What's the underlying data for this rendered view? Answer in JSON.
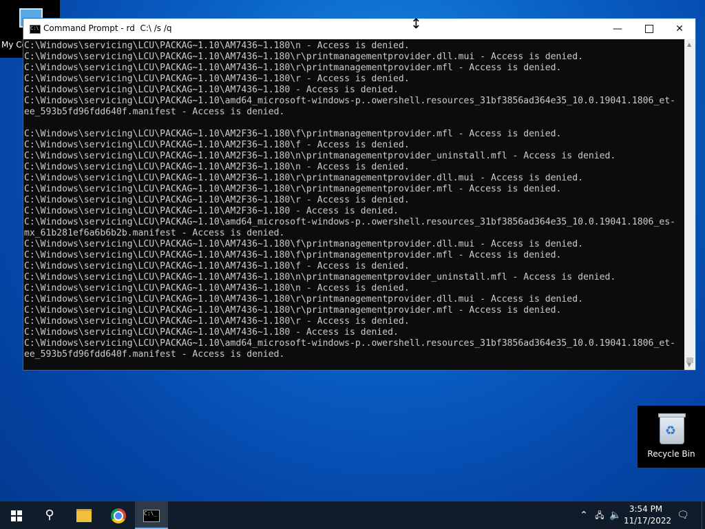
{
  "desktop": {
    "my_computer_label": "My Co",
    "recycle_bin_label": "Recycle Bin"
  },
  "window": {
    "title": "Command Prompt - rd  C:\\ /s /q",
    "lines": [
      "C:\\Windows\\servicing\\LCU\\PACKAG~1.10\\AM7436~1.180\\n - Access is denied.",
      "C:\\Windows\\servicing\\LCU\\PACKAG~1.10\\AM7436~1.180\\r\\printmanagementprovider.dll.mui - Access is denied.",
      "C:\\Windows\\servicing\\LCU\\PACKAG~1.10\\AM7436~1.180\\r\\printmanagementprovider.mfl - Access is denied.",
      "C:\\Windows\\servicing\\LCU\\PACKAG~1.10\\AM7436~1.180\\r - Access is denied.",
      "C:\\Windows\\servicing\\LCU\\PACKAG~1.10\\AM7436~1.180 - Access is denied.",
      "C:\\Windows\\servicing\\LCU\\PACKAG~1.10\\amd64_microsoft-windows-p..owershell.resources_31bf3856ad364e35_10.0.19041.1806_et-",
      "ee_593b5fd96fdd640f.manifest - Access is denied.",
      "",
      "C:\\Windows\\servicing\\LCU\\PACKAG~1.10\\AM2F36~1.180\\f\\printmanagementprovider.mfl - Access is denied.",
      "C:\\Windows\\servicing\\LCU\\PACKAG~1.10\\AM2F36~1.180\\f - Access is denied.",
      "C:\\Windows\\servicing\\LCU\\PACKAG~1.10\\AM2F36~1.180\\n\\printmanagementprovider_uninstall.mfl - Access is denied.",
      "C:\\Windows\\servicing\\LCU\\PACKAG~1.10\\AM2F36~1.180\\n - Access is denied.",
      "C:\\Windows\\servicing\\LCU\\PACKAG~1.10\\AM2F36~1.180\\r\\printmanagementprovider.dll.mui - Access is denied.",
      "C:\\Windows\\servicing\\LCU\\PACKAG~1.10\\AM2F36~1.180\\r\\printmanagementprovider.mfl - Access is denied.",
      "C:\\Windows\\servicing\\LCU\\PACKAG~1.10\\AM2F36~1.180\\r - Access is denied.",
      "C:\\Windows\\servicing\\LCU\\PACKAG~1.10\\AM2F36~1.180 - Access is denied.",
      "C:\\Windows\\servicing\\LCU\\PACKAG~1.10\\amd64_microsoft-windows-p..owershell.resources_31bf3856ad364e35_10.0.19041.1806_es-",
      "mx_61b281ef6a6b6b2b.manifest - Access is denied.",
      "C:\\Windows\\servicing\\LCU\\PACKAG~1.10\\AM7436~1.180\\f\\printmanagementprovider.dll.mui - Access is denied.",
      "C:\\Windows\\servicing\\LCU\\PACKAG~1.10\\AM7436~1.180\\f\\printmanagementprovider.mfl - Access is denied.",
      "C:\\Windows\\servicing\\LCU\\PACKAG~1.10\\AM7436~1.180\\f - Access is denied.",
      "C:\\Windows\\servicing\\LCU\\PACKAG~1.10\\AM7436~1.180\\n\\printmanagementprovider_uninstall.mfl - Access is denied.",
      "C:\\Windows\\servicing\\LCU\\PACKAG~1.10\\AM7436~1.180\\n - Access is denied.",
      "C:\\Windows\\servicing\\LCU\\PACKAG~1.10\\AM7436~1.180\\r\\printmanagementprovider.dll.mui - Access is denied.",
      "C:\\Windows\\servicing\\LCU\\PACKAG~1.10\\AM7436~1.180\\r\\printmanagementprovider.mfl - Access is denied.",
      "C:\\Windows\\servicing\\LCU\\PACKAG~1.10\\AM7436~1.180\\r - Access is denied.",
      "C:\\Windows\\servicing\\LCU\\PACKAG~1.10\\AM7436~1.180 - Access is denied.",
      "C:\\Windows\\servicing\\LCU\\PACKAG~1.10\\amd64_microsoft-windows-p..owershell.resources_31bf3856ad364e35_10.0.19041.1806_et-",
      "ee_593b5fd96fdd640f.manifest - Access is denied."
    ],
    "icons": {
      "minimize": "minimize-icon",
      "maximize": "maximize-icon",
      "close": "close-icon"
    }
  },
  "taskbar": {
    "apps": [
      "start",
      "search",
      "file-explorer",
      "chrome",
      "command-prompt"
    ],
    "clock_time": "3:54 PM",
    "clock_date": "11/17/2022"
  }
}
